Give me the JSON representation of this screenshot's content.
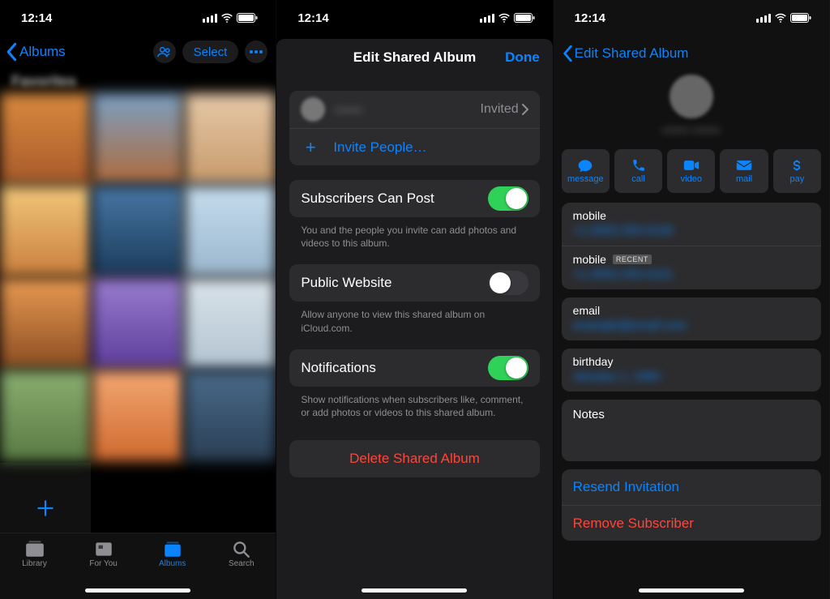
{
  "status": {
    "time": "12:14"
  },
  "panel1": {
    "back_label": "Albums",
    "select_label": "Select",
    "album_title": "Favorites",
    "tabs": {
      "library": "Library",
      "foryou": "For You",
      "albums": "Albums",
      "search": "Search"
    }
  },
  "panel2": {
    "title": "Edit Shared Album",
    "done": "Done",
    "subscriber_name": "——",
    "invited_label": "Invited",
    "invite_people": "Invite People…",
    "subscribers_can_post": "Subscribers Can Post",
    "subscribers_caption": "You and the people you invite can add photos and videos to this album.",
    "public_website": "Public Website",
    "public_caption": "Allow anyone to view this shared album on iCloud.com.",
    "notifications": "Notifications",
    "notifications_caption": "Show notifications when subscribers like, comment, or add photos or videos to this shared album.",
    "delete": "Delete Shared Album"
  },
  "panel3": {
    "back_label": "Edit Shared Album",
    "contact_name": "—— ——",
    "actions": {
      "message": "message",
      "call": "call",
      "video": "video",
      "mail": "mail",
      "pay": "pay"
    },
    "fields": {
      "mobile": "mobile",
      "mobile1_value": "+1 (555) 555-0100",
      "mobile2_value": "+1 (555) 555-0101",
      "recent_badge": "RECENT",
      "email": "email",
      "email_value": "example@email.com",
      "birthday": "birthday",
      "birthday_value": "January 1, 1990",
      "notes": "Notes"
    },
    "resend": "Resend Invitation",
    "remove": "Remove Subscriber"
  }
}
